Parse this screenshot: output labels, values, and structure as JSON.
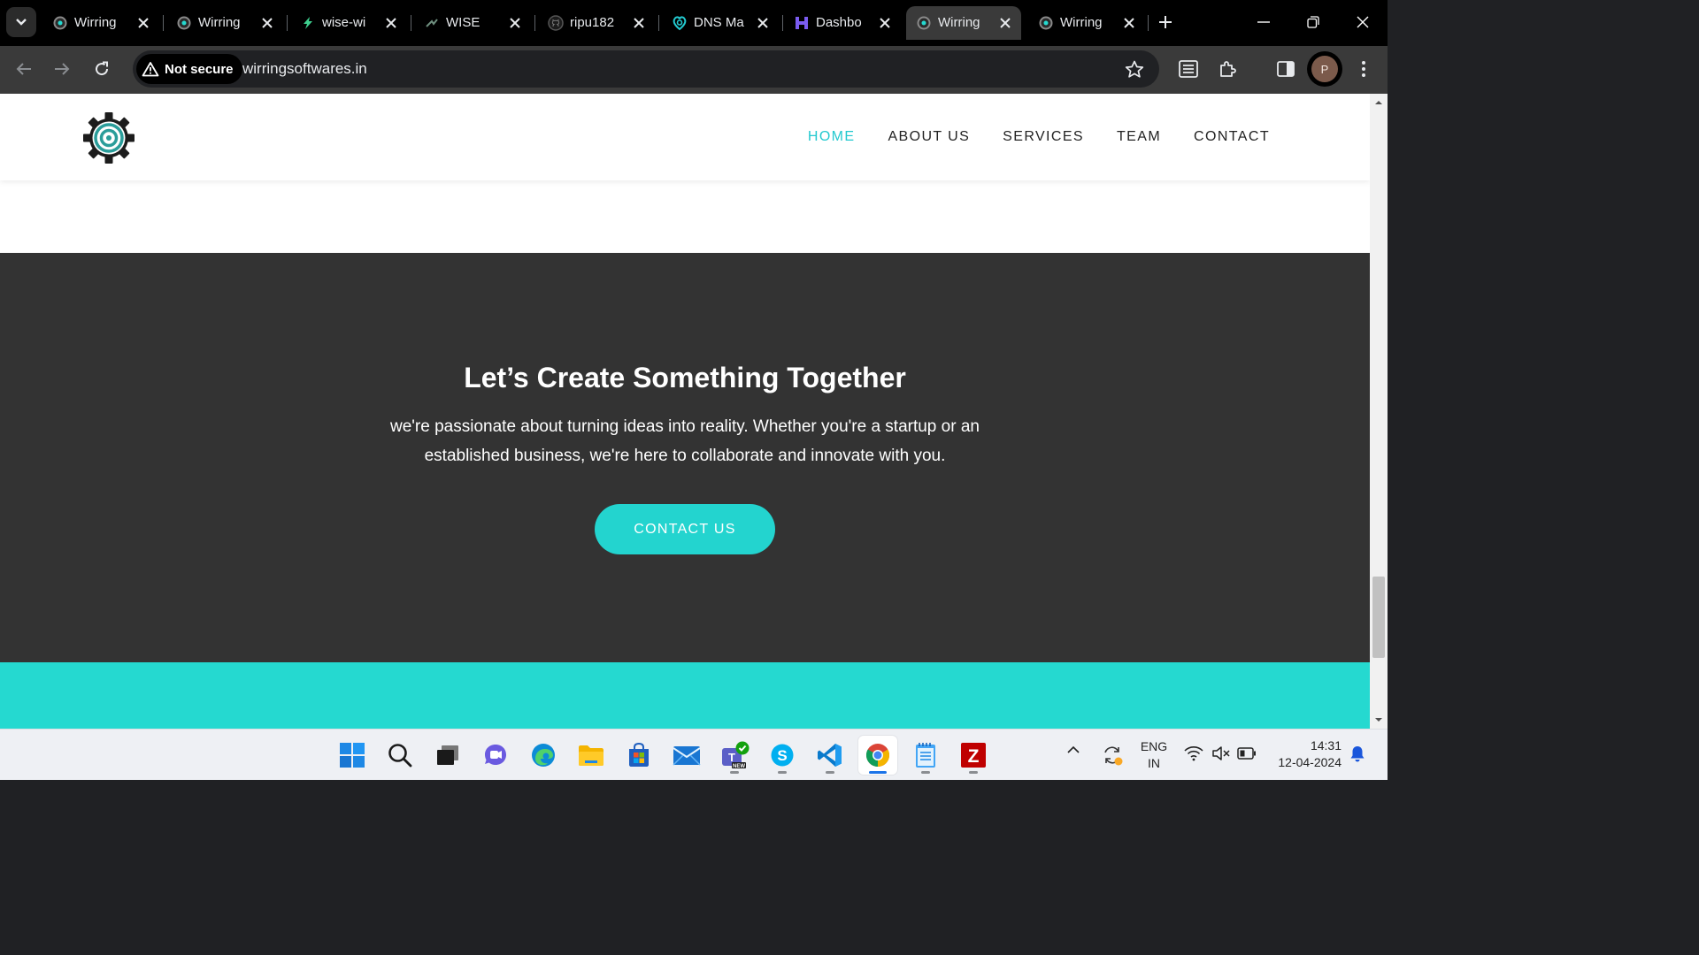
{
  "tabs": [
    {
      "title": "Wirring",
      "favicon": "gear-favicon-icon"
    },
    {
      "title": "Wirring",
      "favicon": "gear-favicon-icon"
    },
    {
      "title": "wise-wi",
      "favicon": "bolt-favicon-icon"
    },
    {
      "title": "WISE",
      "favicon": "wise-favicon-icon"
    },
    {
      "title": "ripu182",
      "favicon": "github-favicon-icon"
    },
    {
      "title": "DNS Ma",
      "favicon": "dns-favicon-icon"
    },
    {
      "title": "Dashbo",
      "favicon": "dashboard-favicon-icon"
    },
    {
      "title": "Wirring",
      "favicon": "gear-favicon-icon",
      "active": true
    },
    {
      "title": "Wirring",
      "favicon": "gear-favicon-icon"
    }
  ],
  "toolbar": {
    "security_label": "Not secure",
    "url": "wirringsoftwares.in",
    "profile_initial": "P"
  },
  "site": {
    "nav": [
      "HOME",
      "ABOUT US",
      "SERVICES",
      "TEAM",
      "CONTACT"
    ],
    "active_nav": "HOME",
    "accent_color": "#23c9cf",
    "cta": {
      "title": "Let’s Create Something Together",
      "text": "we're passionate about turning ideas into reality. Whether you're a startup or an established business, we're here to collaborate and innovate with you.",
      "button": "CONTACT US"
    }
  },
  "taskbar": {
    "apps": [
      "windows-start-icon",
      "search-icon",
      "task-view-icon",
      "chat-icon",
      "edge-icon",
      "file-explorer-icon",
      "microsoft-store-icon",
      "mail-icon",
      "teams-icon",
      "skype-icon",
      "vscode-icon",
      "chrome-icon",
      "notepad-icon",
      "filezilla-icon"
    ],
    "lang_line1": "ENG",
    "lang_line2": "IN",
    "time": "14:31",
    "date": "12-04-2024"
  }
}
